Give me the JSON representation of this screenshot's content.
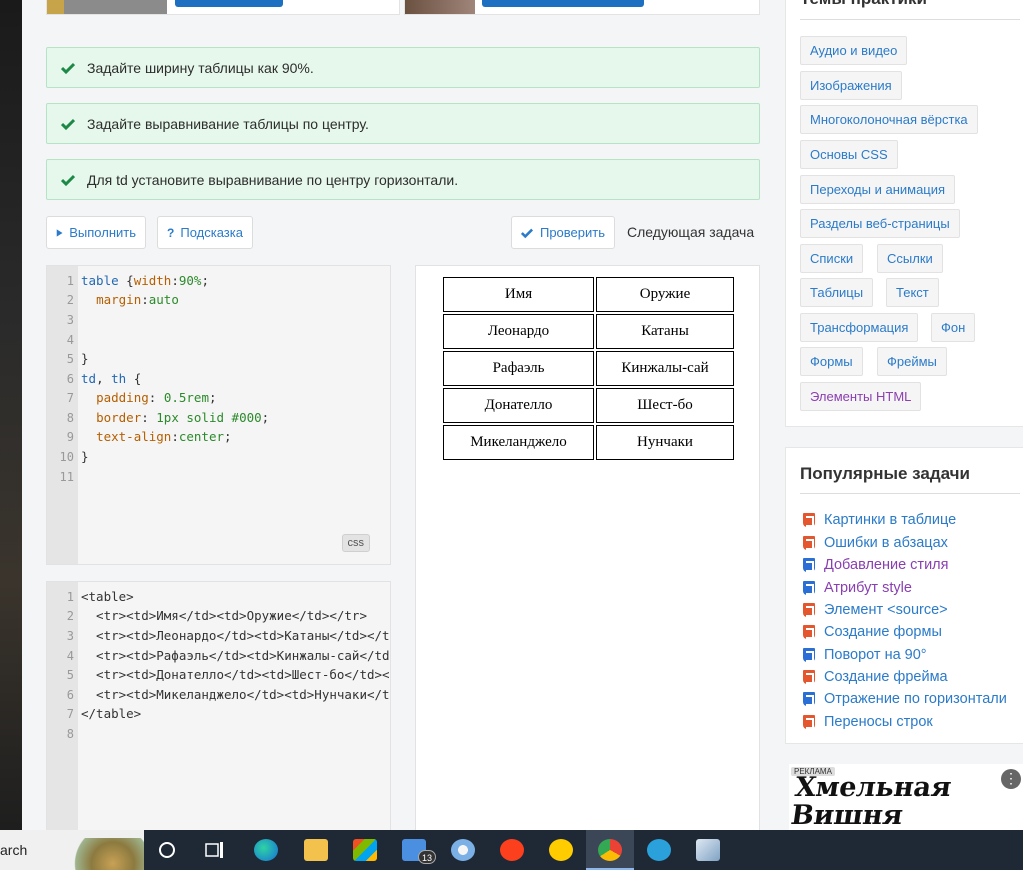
{
  "checks": [
    {
      "text": "Задайте ширину таблицы как 90%."
    },
    {
      "text": "Задайте выравнивание таблицы по центру."
    },
    {
      "text": "Для td установите выравнивание по центру горизонтали."
    }
  ],
  "toolbar": {
    "run_label": "Выполнить",
    "hint_label": "Подсказка",
    "check_label": "Проверить",
    "next_label": "Следующая задача"
  },
  "css_editor": {
    "badge": "css",
    "line_numbers": [
      "1",
      "2",
      "3",
      "4",
      "5",
      "6",
      "7",
      "8",
      "9",
      "10",
      "11"
    ],
    "lines": [
      "table {width:90%;",
      "  margin:auto",
      "",
      "",
      "}",
      "td, th {",
      "  padding: 0.5rem;",
      "  border: 1px solid #000;",
      "  text-align:center;",
      "}",
      ""
    ]
  },
  "html_editor": {
    "line_numbers": [
      "1",
      "2",
      "3",
      "4",
      "5",
      "6",
      "7",
      "8"
    ],
    "lines": [
      "<table>",
      "  <tr><td>Имя</td><td>Оружие</td></tr>",
      "  <tr><td>Леонардо</td><td>Катаны</td></tr>",
      "  <tr><td>Рафаэль</td><td>Кинжалы-сай</td></tr>",
      "  <tr><td>Донателло</td><td>Шест-бо</td></tr>",
      "  <tr><td>Микеланджело</td><td>Нунчаки</td></tr>",
      "</table>",
      ""
    ]
  },
  "preview_table": [
    [
      "Имя",
      "Оружие"
    ],
    [
      "Леонардо",
      "Катаны"
    ],
    [
      "Рафаэль",
      "Кинжалы-сай"
    ],
    [
      "Донателло",
      "Шест-бо"
    ],
    [
      "Микеланджело",
      "Нунчаки"
    ]
  ],
  "sidebar": {
    "topics_title": "Темы практики",
    "topics": [
      "Аудио и видео",
      "Изображения",
      "Многоколоночная вёрстка",
      "Основы CSS",
      "Переходы и анимация",
      "Разделы веб-страницы",
      "Списки",
      "Ссылки",
      "Таблицы",
      "Текст",
      "Трансформация",
      "Фон",
      "Формы",
      "Фреймы",
      "Элементы HTML"
    ],
    "popular_title": "Популярные задачи",
    "popular": [
      {
        "label": "Картинки в таблице",
        "icon": "html5-icon"
      },
      {
        "label": "Ошибки в абзацах",
        "icon": "html5-icon"
      },
      {
        "label": "Добавление стиля",
        "icon": "css3-icon"
      },
      {
        "label": "Атрибут style",
        "icon": "css3-icon"
      },
      {
        "label": "Элемент <source>",
        "icon": "html5-icon"
      },
      {
        "label": "Создание формы",
        "icon": "html5-icon"
      },
      {
        "label": "Поворот на 90°",
        "icon": "css3-icon"
      },
      {
        "label": "Создание фрейма",
        "icon": "html5-icon"
      },
      {
        "label": "Отражение по горизонтали",
        "icon": "css3-icon"
      },
      {
        "label": "Переносы строк",
        "icon": "html5-icon"
      }
    ]
  },
  "ad": {
    "label": "РЕКЛАМА",
    "brand": "Хмельная Вишня"
  },
  "taskbar": {
    "search_text": "arch",
    "mail_badge": "13"
  },
  "colors": {
    "accent": "#2b7bc9",
    "success_bg": "#e6f8ec",
    "success_icon": "#1c8a46",
    "visited": "#8a3fb0"
  }
}
